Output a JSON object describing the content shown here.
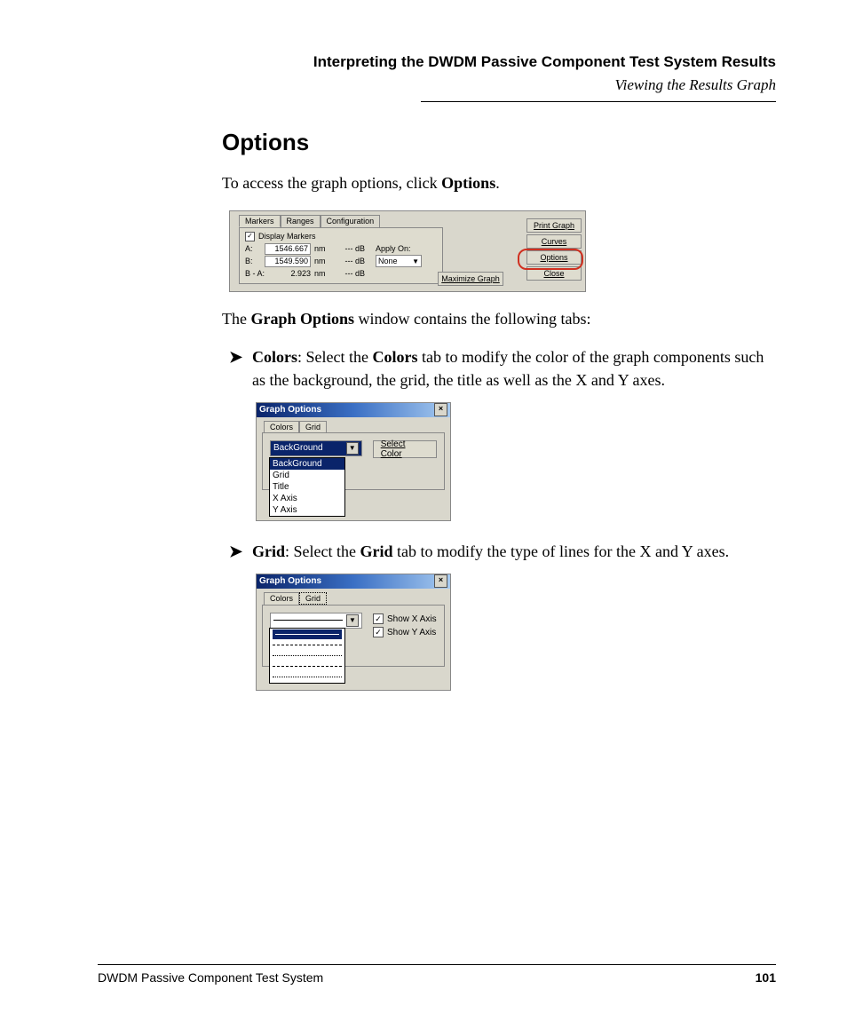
{
  "header": {
    "title": "Interpreting the DWDM Passive Component Test System Results",
    "subtitle": "Viewing the Results Graph"
  },
  "section": {
    "heading": "Options"
  },
  "intro": {
    "pre": "To access the graph options, click ",
    "bold": "Options",
    "post": "."
  },
  "panel1": {
    "tabs": [
      "Markers",
      "Ranges",
      "Configuration"
    ],
    "display_markers": "Display Markers",
    "rowA": {
      "label": "A:",
      "value": "1546.667",
      "unit": "nm",
      "db": "--- dB",
      "apply": "Apply On:"
    },
    "rowB": {
      "label": "B:",
      "value": "1549.590",
      "unit": "nm",
      "db": "--- dB",
      "sel": "None"
    },
    "rowBA": {
      "label": "B - A:",
      "value": "2.923",
      "unit": "nm",
      "db": "--- dB"
    },
    "buttons": {
      "print": "Print Graph",
      "curves": "Curves",
      "options": "Options",
      "close": "Close",
      "max": "Maximize Graph"
    }
  },
  "mid": {
    "pre": "The ",
    "bold": "Graph Options",
    "post": " window contains the following tabs:"
  },
  "bullet1": {
    "b1": "Colors",
    "t1": ": Select the ",
    "b2": "Colors",
    "t2": " tab to modify the color of the graph components such as the background, the grid, the title as well as the X and Y axes."
  },
  "panel2": {
    "title": "Graph Options",
    "tabs": [
      "Colors",
      "Grid"
    ],
    "combo": "BackGround",
    "button": "Select Color",
    "list": [
      "BackGround",
      "Grid",
      "Title",
      "X Axis",
      "Y Axis"
    ]
  },
  "bullet2": {
    "b1": "Grid",
    "t1": ": Select the ",
    "b2": "Grid",
    "t2": " tab to modify the type of lines for the X and Y axes."
  },
  "panel3": {
    "title": "Graph Options",
    "tabs": [
      "Colors",
      "Grid"
    ],
    "chk1": "Show X Axis",
    "chk2": "Show Y Axis"
  },
  "footer": {
    "left": "DWDM Passive Component Test System",
    "page": "101"
  }
}
